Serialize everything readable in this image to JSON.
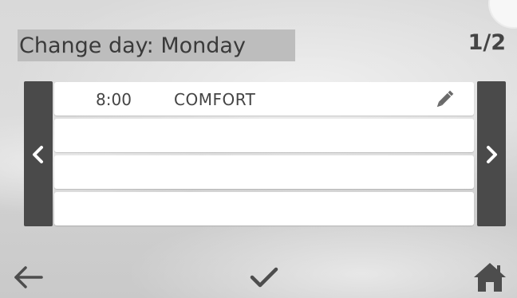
{
  "header": {
    "title": "Change day: Monday",
    "page_indicator": "1/2"
  },
  "schedule": {
    "slots": [
      {
        "time": "8:00",
        "mode": "COMFORT",
        "edit_icon": "pencil-icon"
      },
      {
        "time": "",
        "mode": ""
      },
      {
        "time": "",
        "mode": ""
      },
      {
        "time": "",
        "mode": ""
      }
    ]
  },
  "navigation": {
    "prev_icon": "chevron-left-icon",
    "next_icon": "chevron-right-icon"
  },
  "footer": {
    "back_icon": "arrow-left-icon",
    "confirm_icon": "checkmark-icon",
    "home_icon": "home-icon"
  },
  "colors": {
    "side_button": "#4a4a4a",
    "title_highlight": "#bdbdbd",
    "text": "#444444"
  }
}
